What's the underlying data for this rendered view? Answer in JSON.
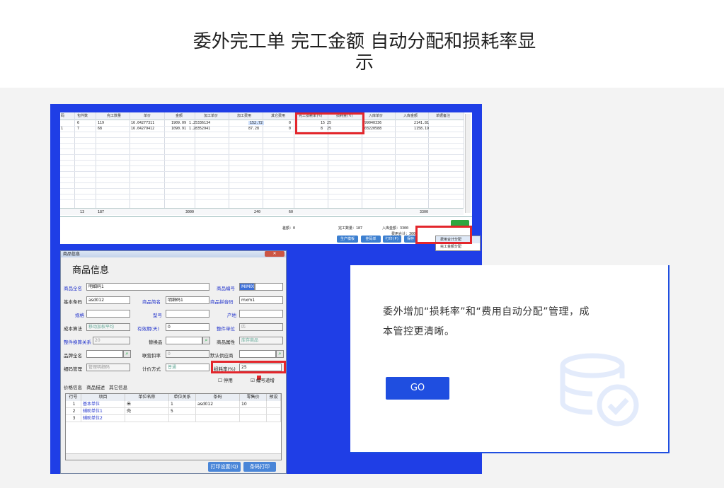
{
  "heading": {
    "line1": "委外完工单 完工金额 自动分配和损耗率显",
    "line2": "示"
  },
  "grid": {
    "headers": [
      "码",
      "包件数",
      "完工数量",
      "单价",
      "金额",
      "加工单价",
      "加工费用",
      "其它费用",
      "完工损耗率(%)",
      "损耗量(%)",
      "入库单价",
      "入库金额",
      "单据备注"
    ],
    "rows": [
      [
        "",
        "6",
        "119",
        "16.04277311",
        "1909.09",
        "1.25336134",
        "152.72",
        "0",
        "25",
        "15",
        "99040336",
        "2141.81",
        ""
      ],
      [
        "1",
        "7",
        "68",
        "16.04279412",
        "1090.91",
        "1.28352941",
        "87.28",
        "0",
        "25",
        "8",
        "03220588",
        "1158.19",
        ""
      ]
    ],
    "totals": {
      "c1": "13",
      "c2": "187",
      "c4": "3000",
      "c6": "240",
      "c7": "60",
      "c11": "3300"
    }
  },
  "footer": {
    "diff": "差额：0",
    "qty": "完工数量：187",
    "amount": "入库金额：3300",
    "fee": "费用合计：300",
    "buttons": [
      "生产模板",
      "挂码单",
      "打印(P)",
      "保存"
    ],
    "menu": [
      "费用合计分配",
      "完工金额分配"
    ]
  },
  "dialog": {
    "titlebar": "商品信息",
    "title": "商品信息",
    "fields": {
      "fullname_label": "商品全名",
      "fullname": "明细码1",
      "code_label": "商品编号",
      "code": "MIM001",
      "barcode_label": "基本条码",
      "barcode": "asd012",
      "short_label": "商品简名",
      "short": "明细码1",
      "pinyin_label": "商品拼音码",
      "pinyin": "mxm1",
      "spec_label": "规格",
      "model_label": "型号",
      "origin_label": "产地",
      "cost_label": "成本算法",
      "cost": "移动加权平均",
      "valid_label": "有效期(天)",
      "valid": "0",
      "unit_label": "整件单位",
      "unit": "匹",
      "ratio_label": "整件换算关系",
      "ratio": "20",
      "sub_label": "替换品",
      "attr_label": "商品属性",
      "attr": "库存商品",
      "brand_label": "品牌全名",
      "discount_label": "联营扣率",
      "discount": "0",
      "supplier_label": "默认供应商",
      "detail_label": "细码管理",
      "detail": "管理明细码",
      "price_label": "计价方式",
      "price": "普通",
      "loss_label": "损耗率(%)",
      "loss": "25",
      "stop_label": "停用",
      "inc_label": "编号递增"
    },
    "tabs": [
      "价格信息",
      "商品描述",
      "其它信息"
    ],
    "table_headers": [
      "行号",
      "项目",
      "单位名称",
      "单位关系",
      "条码",
      "零售价",
      "预设"
    ],
    "table_rows": [
      [
        "1",
        "基本单位",
        "米",
        "1",
        "asd012",
        "10",
        ""
      ],
      [
        "2",
        "辅助单位1",
        "壳",
        "5",
        "",
        "",
        ""
      ],
      [
        "3",
        "辅助单位2",
        "",
        "",
        "",
        "",
        ""
      ]
    ],
    "buttons": [
      "打印设置(Q)",
      "条码打印"
    ]
  },
  "card": {
    "text": "委外增加“损耗率”和“费用自动分配”管理，成本管控更清晰。",
    "button": "GO"
  }
}
